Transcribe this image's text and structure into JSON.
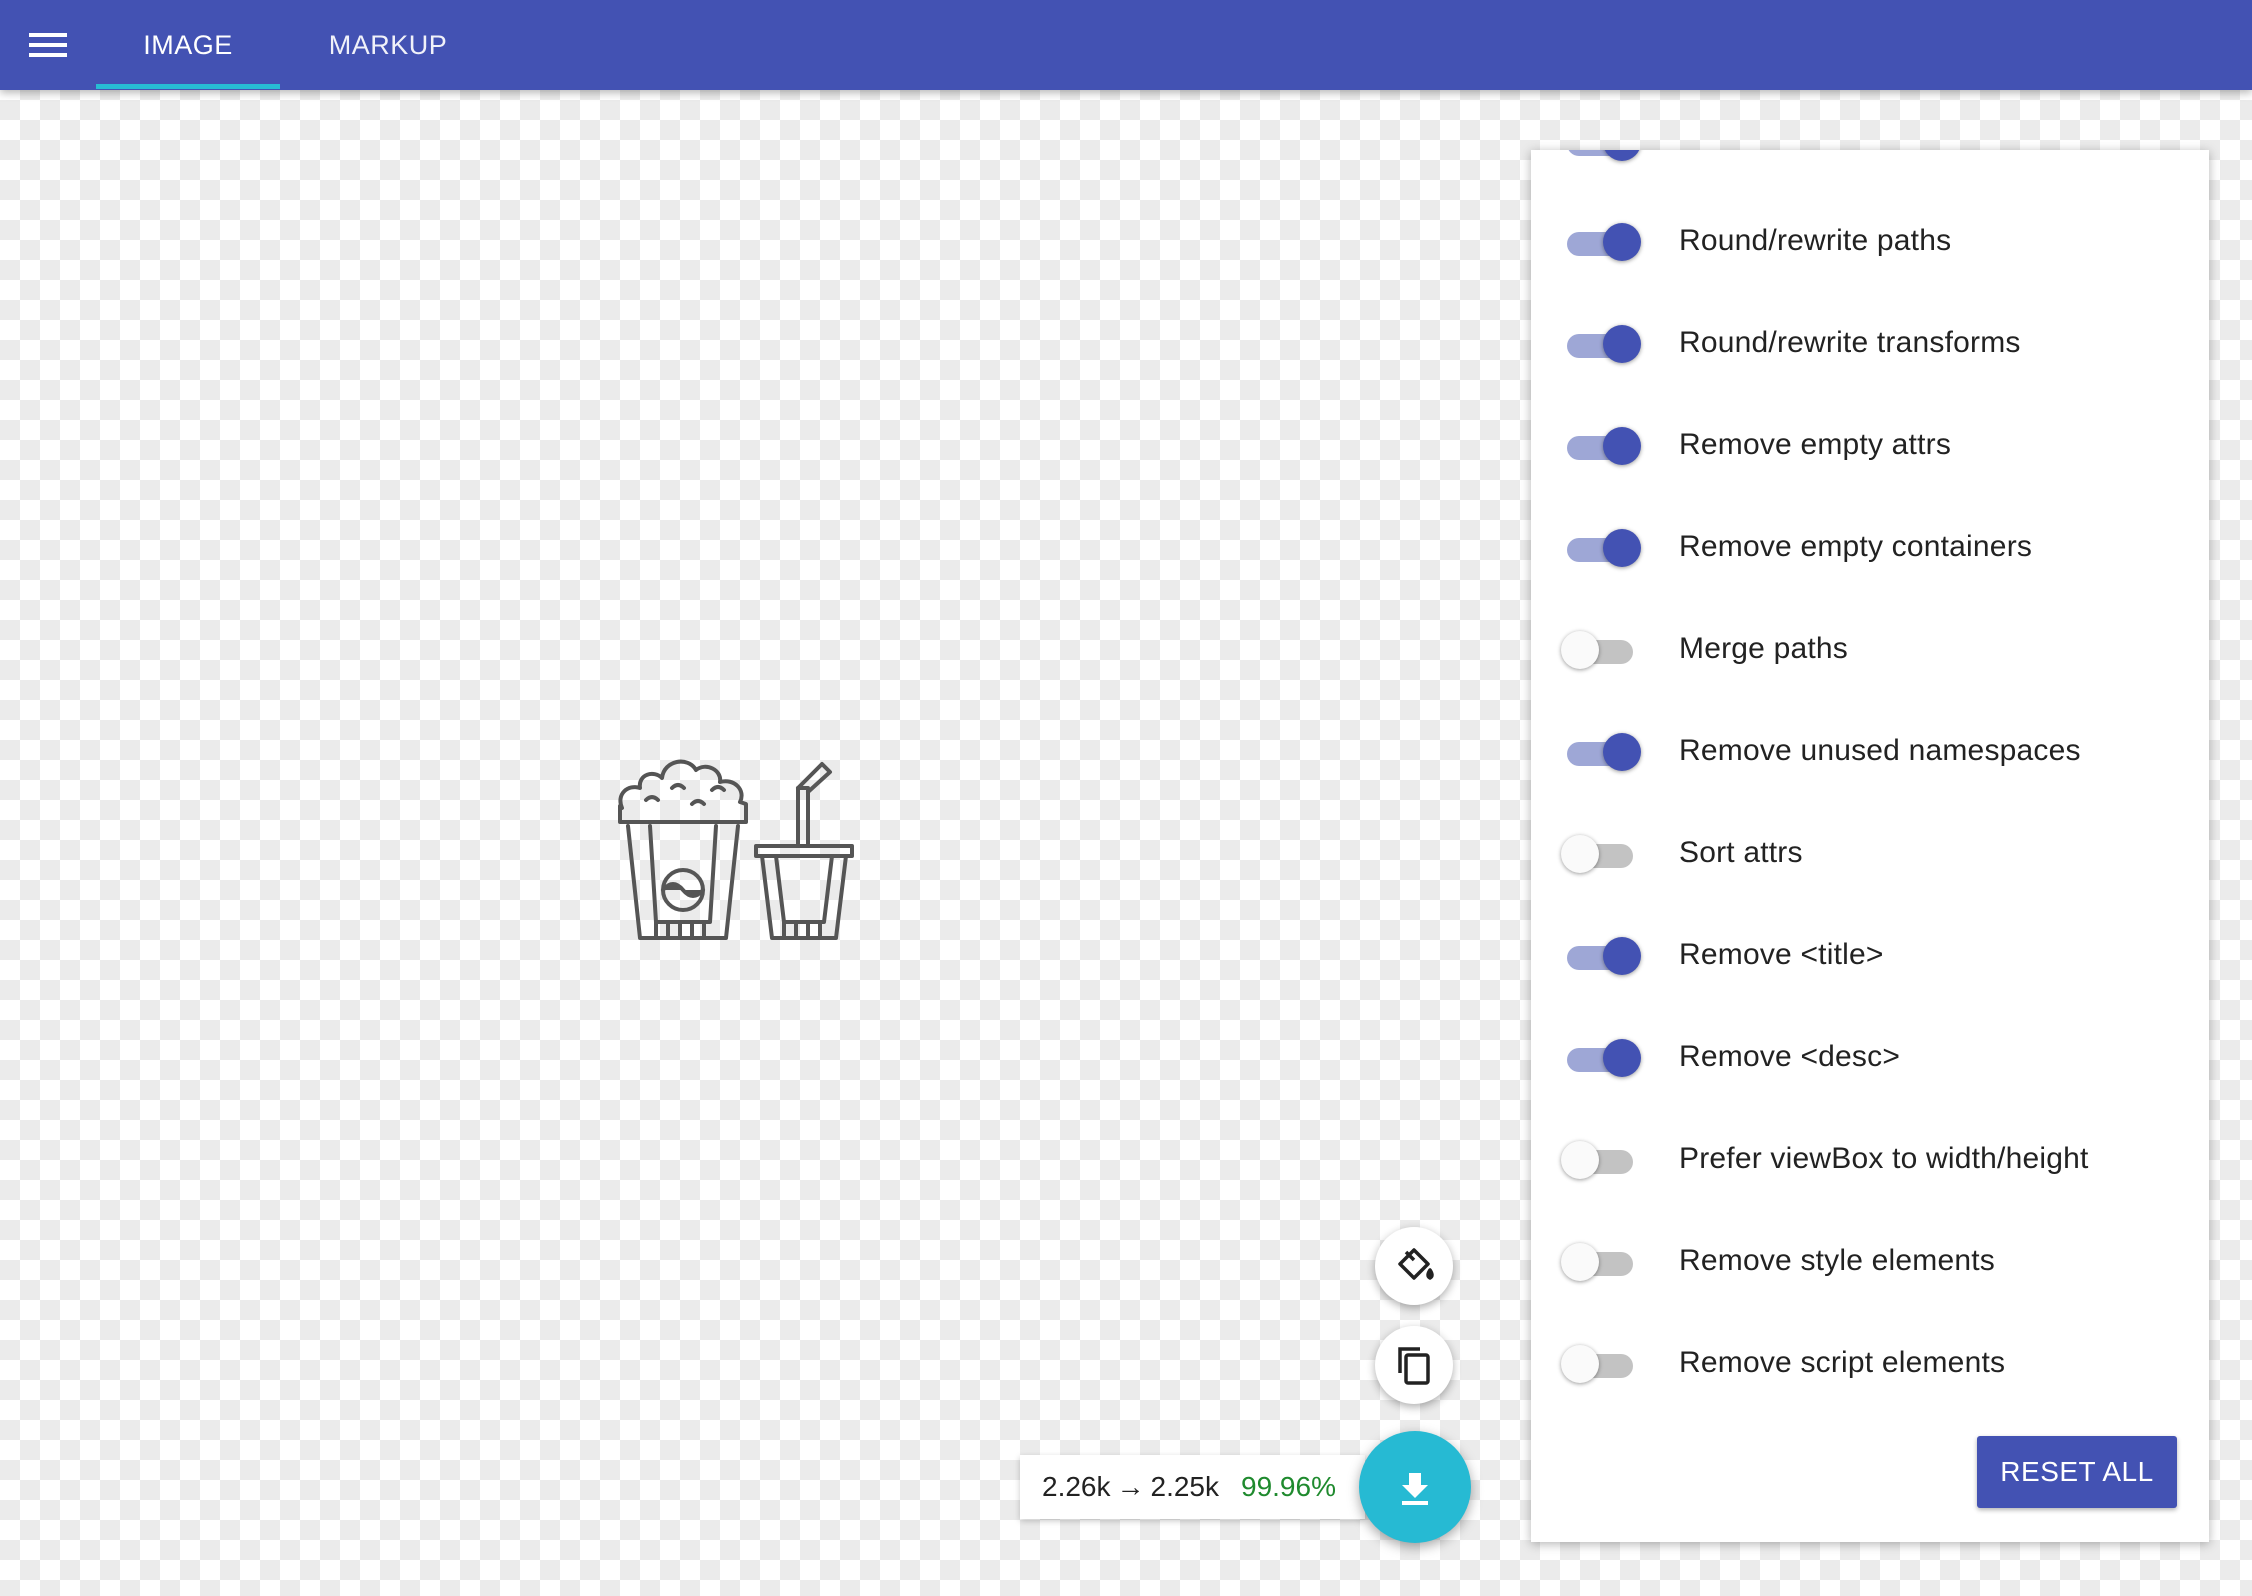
{
  "app_bar": {
    "menu_icon": "hamburger-menu-icon",
    "tabs": [
      {
        "label": "IMAGE",
        "active": true
      },
      {
        "label": "MARKUP",
        "active": false
      }
    ],
    "accent_color": "#27bcd4",
    "bar_color": "#4352b3"
  },
  "preview": {
    "icon": "popcorn-and-drink-icon"
  },
  "actions": {
    "background_toggle_icon": "paint-bucket-icon",
    "copy_icon": "copy-icon",
    "download_icon": "download-icon",
    "size_before": "2.26k",
    "arrow": "→",
    "size_after": "2.25k",
    "savings_percent": "99.96%"
  },
  "settings": {
    "options": [
      {
        "label": "Round/rewrite paths",
        "enabled": true
      },
      {
        "label": "Round/rewrite transforms",
        "enabled": true
      },
      {
        "label": "Remove empty attrs",
        "enabled": true
      },
      {
        "label": "Remove empty containers",
        "enabled": true
      },
      {
        "label": "Merge paths",
        "enabled": false
      },
      {
        "label": "Remove unused namespaces",
        "enabled": true
      },
      {
        "label": "Sort attrs",
        "enabled": false
      },
      {
        "label": "Remove <title>",
        "enabled": true
      },
      {
        "label": "Remove <desc>",
        "enabled": true
      },
      {
        "label": "Prefer viewBox to width/height",
        "enabled": false
      },
      {
        "label": "Remove style elements",
        "enabled": false
      },
      {
        "label": "Remove script elements",
        "enabled": false
      }
    ],
    "reset_label": "RESET ALL"
  }
}
